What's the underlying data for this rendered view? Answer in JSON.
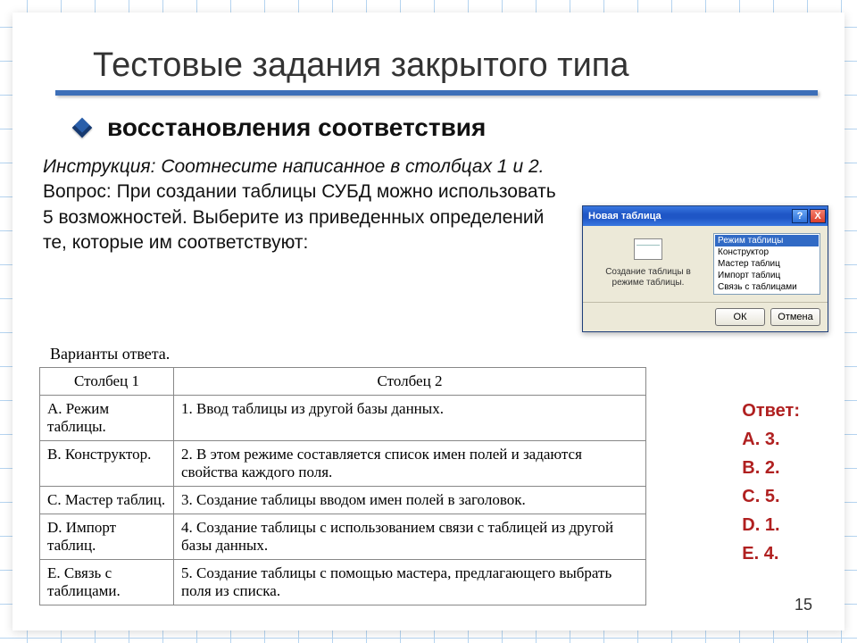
{
  "title": "Тестовые задания закрытого типа",
  "subtitle": "восстановления соответствия",
  "instruction_label": "Инструкция:",
  "instruction_text": "Соотнесите написанное в столбцах 1 и 2.",
  "question_label": "Вопрос:",
  "question_text": "При создании таблицы СУБД можно использовать 5 возможностей. Выберите из приведенных определений те, которые им соответствуют:",
  "variants_label": "Варианты ответа.",
  "table": {
    "head_col1": "Столбец 1",
    "head_col2": "Столбец 2",
    "rows": [
      {
        "c1": "A. Режим таблицы.",
        "c2": "1. Ввод таблицы из другой базы данных."
      },
      {
        "c1": "B. Конструктор.",
        "c2": "2. В этом режиме составляется список имен полей и задаются свойства каждого поля."
      },
      {
        "c1": "C. Мастер таблиц.",
        "c2": "3. Создание таблицы вводом имен полей в заголовок."
      },
      {
        "c1": "D. Импорт таблиц.",
        "c2": "4. Создание таблицы с использованием связи с таблицей из другой базы данных."
      },
      {
        "c1": "E. Связь с таблицами.",
        "c2": "5. Создание таблицы с помощью мастера, предлагающего выбрать поля из списка."
      }
    ]
  },
  "dialog": {
    "title": "Новая таблица",
    "help": "?",
    "close": "X",
    "caption": "Создание таблицы в режиме таблицы.",
    "items": [
      "Режим таблицы",
      "Конструктор",
      "Мастер таблиц",
      "Импорт таблиц",
      "Связь с таблицами"
    ],
    "ok": "ОК",
    "cancel": "Отмена"
  },
  "answers": {
    "label": "Ответ:",
    "lines": [
      "А. 3.",
      "В. 2.",
      "С. 5.",
      "D. 1.",
      "Е. 4."
    ]
  },
  "page_number": "15"
}
